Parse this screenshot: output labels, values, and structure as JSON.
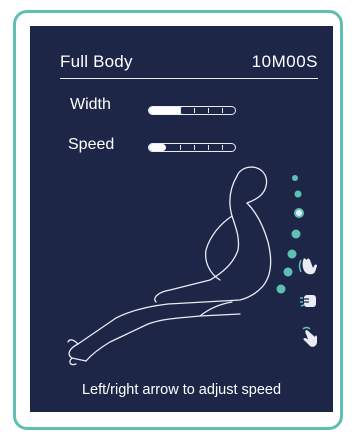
{
  "program": {
    "title": "Full Body",
    "time": "10M00S"
  },
  "settings": [
    {
      "label": "Width",
      "level": 0.4
    },
    {
      "label": "Speed",
      "level": 0.2
    }
  ],
  "hint": "Left/right arrow to adjust speed",
  "icons": [
    "kneading-hand-icon",
    "tapping-hand-icon",
    "rolling-hand-icon"
  ],
  "colors": {
    "screen": "#1d2647",
    "accent": "#5fbfb3",
    "text": "#ffffff"
  }
}
